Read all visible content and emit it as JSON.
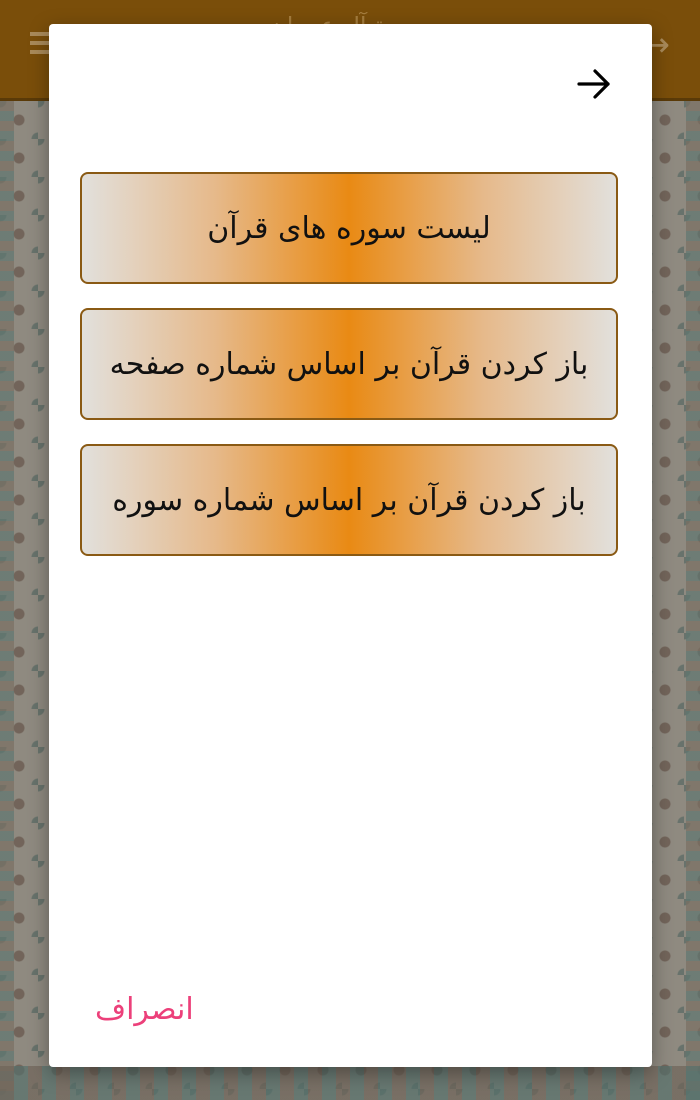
{
  "app": {
    "title": "... سورة آل عمران ..."
  },
  "dialog": {
    "options": [
      {
        "label": "لیست سوره های قرآن"
      },
      {
        "label": "باز کردن قرآن بر اساس شماره صفحه"
      },
      {
        "label": "باز کردن قرآن بر اساس شماره سوره"
      }
    ],
    "cancel_label": "انصراف",
    "close_icon": "arrow-right-icon"
  },
  "colors": {
    "appbar": "#7a4e0a",
    "button_center": "#e98a14",
    "button_edge": "#e2e0dc",
    "button_border": "#8a5a14",
    "cancel": "#ec407a"
  }
}
